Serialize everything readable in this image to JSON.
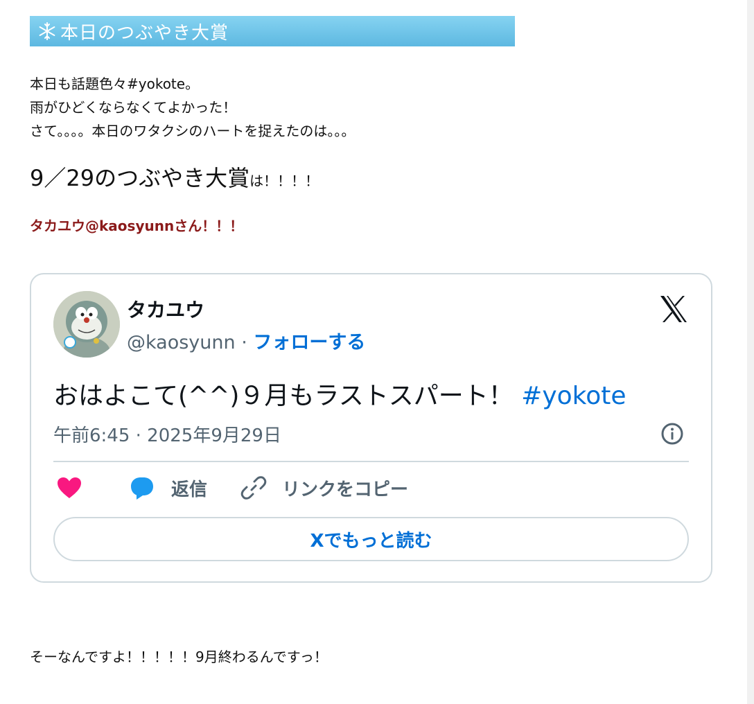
{
  "section_title": {
    "text": "本日のつぶやき大賞",
    "icon": "snowflake-icon"
  },
  "intro_lines": [
    "本日も話題色々#yokote。",
    "雨がひどくならなくてよかった！",
    "さて。。。。本日のワタクシのハートを捉えたのは。。。"
  ],
  "headline": {
    "big": "9／29のつぶやき大賞",
    "small": "は！！！！"
  },
  "winner": "タカユウ@kaosyunnさん！！！",
  "tweet": {
    "display_name": "タカユウ",
    "handle": "@kaosyunn",
    "separator": " · ",
    "follow_label": "フォローする",
    "text": "おはよこて(^^)９月もラストスパート！ ",
    "hashtag": "#yokote",
    "timestamp": "午前6:45 · 2025年9月29日",
    "actions": {
      "reply_label": "返信",
      "copy_label": "リンクをコピー"
    },
    "read_more_label": "Xでもっと読む"
  },
  "footer": "そーなんですよ！！！！！9月終わるんですっ！",
  "colors": {
    "title_banner": "#6ec6ea",
    "winner_text": "#8b1a1a",
    "link_blue": "#006fd6",
    "like_pink": "#f91880",
    "reply_blue": "#1d9bf0",
    "muted": "#536471",
    "border": "#cfd9de"
  },
  "icons": [
    "snowflake-icon",
    "x-logo-icon",
    "info-icon",
    "heart-icon",
    "reply-bubble-icon",
    "link-icon"
  ]
}
